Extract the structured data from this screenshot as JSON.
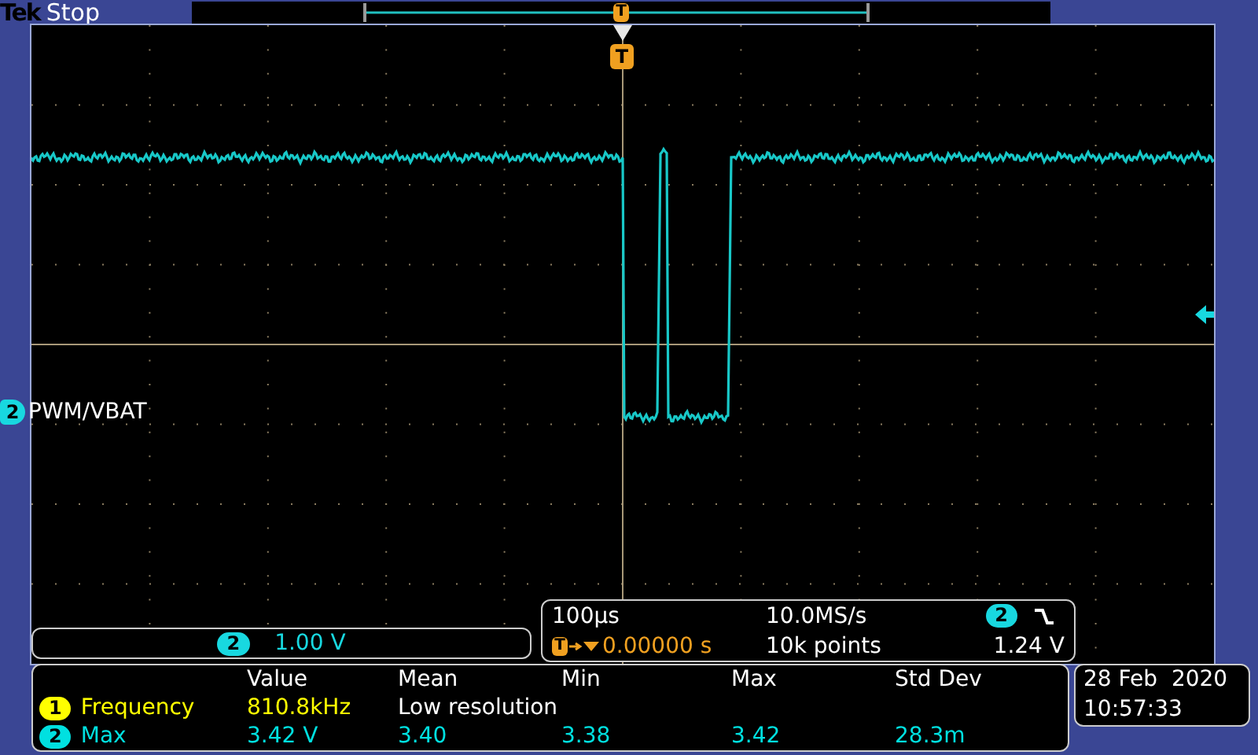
{
  "header": {
    "brand": "Tek",
    "status": "Stop",
    "trigger_marker": "T"
  },
  "display": {
    "trigger_marker": "T",
    "channel_marker": "2",
    "channel_name": "PWM/VBAT"
  },
  "vertical_scale": {
    "channel": "2",
    "scale": "1.00 V"
  },
  "timebase": {
    "time_per_div": "100µs",
    "sample_rate": "10.0MS/s",
    "trigger_channel": "2",
    "trigger_marker": "T",
    "position": "0.00000 s",
    "record_length": "10k points",
    "trigger_level": "1.24 V"
  },
  "measurements": {
    "columns": [
      "Value",
      "Mean",
      "Min",
      "Max",
      "Std Dev"
    ],
    "rows": [
      {
        "channel": "1",
        "color": "#ffff00",
        "name": "Frequency",
        "cells": [
          {
            "text": "810.8kHz",
            "kind": "value"
          },
          {
            "text": "Low resolution",
            "kind": "note"
          }
        ]
      },
      {
        "channel": "2",
        "color": "#00e0e0",
        "name": "Max",
        "cells": [
          {
            "text": "3.42 V",
            "kind": "value"
          },
          {
            "text": "3.40",
            "kind": "value"
          },
          {
            "text": "3.38",
            "kind": "value"
          },
          {
            "text": "3.42",
            "kind": "value"
          },
          {
            "text": "28.3m",
            "kind": "value"
          }
        ]
      }
    ]
  },
  "datetime": {
    "date": "28 Feb  2020",
    "time": "10:57:33"
  }
}
